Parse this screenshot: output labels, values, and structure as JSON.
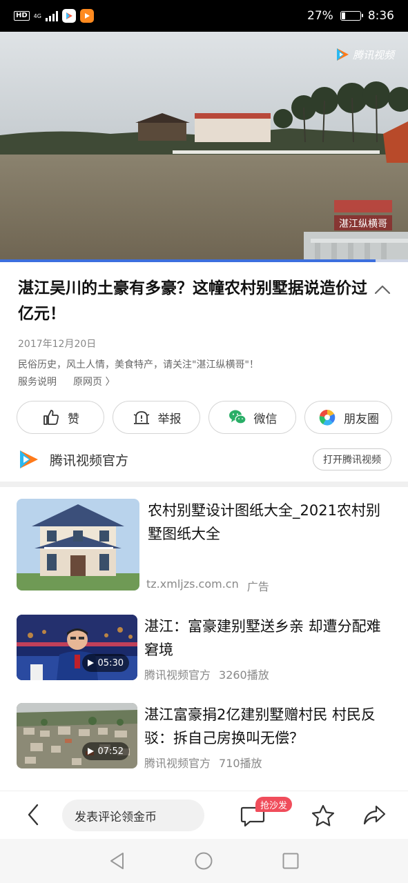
{
  "status_bar": {
    "hd": "HD",
    "network": "4G",
    "battery_text": "27%",
    "battery_level": 0.27,
    "time": "8:36"
  },
  "video": {
    "brand": "腾讯视频",
    "watermark": "湛江纵横哥",
    "progress": 0.92
  },
  "article": {
    "title": "湛江吴川的土豪有多豪？这幢农村别墅据说造价过亿元！",
    "date": "2017年12月20日",
    "description": "民俗历史，风土人情，美食特产，请关注\"湛江纵横哥\"！",
    "service_link": "服务说明",
    "source_link": "原网页 〉"
  },
  "actions": [
    {
      "label": "赞",
      "icon": "thumbs-up-icon"
    },
    {
      "label": "举报",
      "icon": "report-icon"
    },
    {
      "label": "微信",
      "icon": "wechat-icon"
    },
    {
      "label": "朋友圈",
      "icon": "moments-icon"
    }
  ],
  "source": {
    "name": "腾讯视频官方",
    "open_button": "打开腾讯视频"
  },
  "recommendations": [
    {
      "title": "农村别墅设计图纸大全_2021农村别墅图纸大全",
      "domain": "tz.xmljzs.com.cn",
      "tag": "广告"
    },
    {
      "title": "湛江：富豪建别墅送乡亲 却遭分配难窘境",
      "duration": "05:30",
      "source": "腾讯视频官方",
      "plays": "3260播放"
    },
    {
      "title": "湛江富豪捐2亿建别墅赠村民 村民反驳：拆自己房换叫无偿？",
      "duration": "07:52",
      "source": "腾讯视频官方",
      "plays": "710播放"
    }
  ],
  "bottom_bar": {
    "comment_placeholder": "发表评论领金币",
    "sofa_badge": "抢沙发"
  },
  "colors": {
    "accent_blue": "#3c6fde",
    "badge_red": "#f04d5b",
    "wechat_green": "#2aae67"
  }
}
